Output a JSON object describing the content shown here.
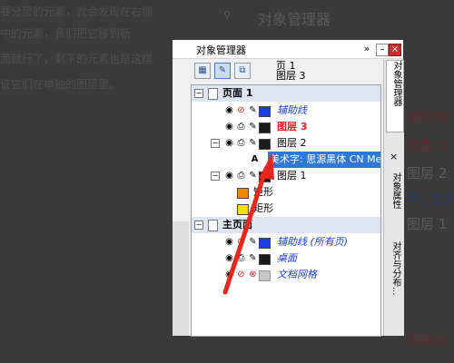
{
  "article": {
    "lines": [
      "要分层的元素，就会发现在右侧",
      "中的元素，我们把它移到新",
      "面就行了，剩下的元素也是这样",
      "证它们在单独的图层里。"
    ]
  },
  "background": {
    "title": "对象管理器",
    "right_labels": [
      "辅助线",
      "图层 3",
      "图层 2",
      "字: 思源",
      "图层 1",
      "辅助线"
    ]
  },
  "docker": {
    "title": "对象管理器",
    "chevron": "»",
    "minimize": "–",
    "close": "×",
    "toolbar": {
      "page_line1": "页 1",
      "page_line2": "图层 3",
      "next_glyph": "▶"
    },
    "tree": {
      "page1_label": "页面 1",
      "page1_expander": "−",
      "rows": {
        "guides": "辅助线",
        "layer3": "图层 3",
        "layer2": "图层 2",
        "layer2_expander": "−",
        "art_text": "美术字: 思源黑体 CN Medi",
        "layer1": "图层 1",
        "layer1_expander": "−",
        "rect1": "矩形",
        "rect2": "矩形"
      },
      "master_label": "主页面",
      "master_expander": "−",
      "master_rows": {
        "guides_all": "辅助线 (所有页)",
        "desktop": "桌面",
        "doc_grid": "文档网格"
      }
    },
    "vtabs": {
      "tab1": "对象管理器",
      "close": "×",
      "tab2": "对象属性",
      "tab3": "对齐与分布..."
    }
  },
  "colors": {
    "selection": "#3078d8",
    "red_layer": "#e02020",
    "guide_blue": "#1a3fe0",
    "master_blue": "#1a3fe0",
    "swatch_orange": "#f08a00",
    "swatch_yellow": "#f8e000",
    "arrow_red": "#e8261c"
  }
}
